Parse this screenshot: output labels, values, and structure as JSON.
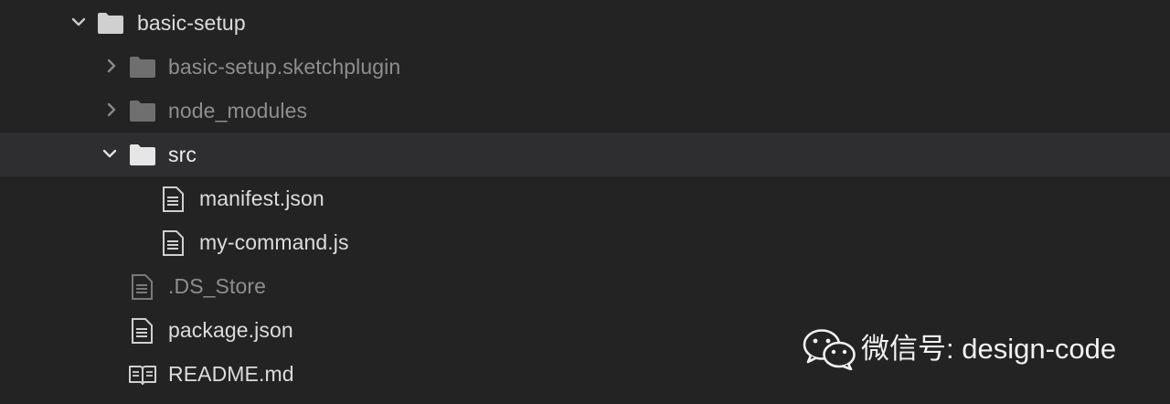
{
  "tree": {
    "root": {
      "label": "basic-setup",
      "expanded": true,
      "icon": "folder-icon"
    },
    "items": [
      {
        "label": "basic-setup.sketchplugin",
        "type": "folder",
        "expanded": false,
        "icon": "folder-icon"
      },
      {
        "label": "node_modules",
        "type": "folder",
        "expanded": false,
        "icon": "folder-icon"
      },
      {
        "label": "src",
        "type": "folder",
        "expanded": true,
        "selected": true,
        "icon": "folder-icon"
      },
      {
        "label": "manifest.json",
        "type": "file",
        "icon": "file-icon"
      },
      {
        "label": "my-command.js",
        "type": "file",
        "icon": "file-icon"
      },
      {
        "label": ".DS_Store",
        "type": "file",
        "icon": "file-icon"
      },
      {
        "label": "package.json",
        "type": "file",
        "icon": "file-icon"
      },
      {
        "label": "README.md",
        "type": "file",
        "icon": "book-icon"
      }
    ]
  },
  "watermark": {
    "text": "微信号: design-code",
    "icon": "wechat-icon"
  },
  "colors": {
    "background": "#232324",
    "selected_row": "#2e2e30",
    "text_bright": "#dcdcdc",
    "text_dim": "#8e8e8e"
  }
}
